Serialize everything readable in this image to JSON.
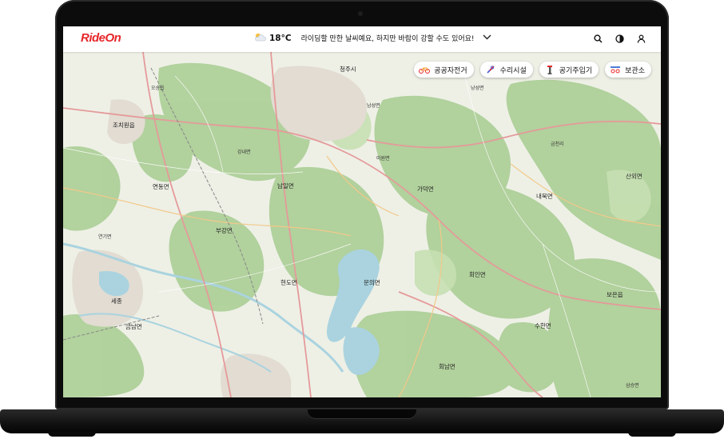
{
  "app": {
    "logo_text": "RideOn"
  },
  "weather": {
    "icon": "partly-cloudy-icon",
    "temperature": "18°C",
    "message": "라이딩할 만한 날씨예요, 하지만 바람이 강할 수도 있어요!"
  },
  "header_icons": [
    "search-icon",
    "theme-toggle-icon",
    "user-icon"
  ],
  "filters": [
    {
      "label": "공공자전거",
      "icon": "bicycle-icon"
    },
    {
      "label": "수리시설",
      "icon": "wrench-icon"
    },
    {
      "label": "공기주입기",
      "icon": "air-pump-icon"
    },
    {
      "label": "보관소",
      "icon": "bike-storage-icon"
    }
  ],
  "colors": {
    "brand": "#e8262a",
    "map_green": "#aed09a",
    "map_water": "#aad3df"
  },
  "map_labels": [
    {
      "text": "청주시"
    },
    {
      "text": "조치원읍"
    },
    {
      "text": "연동면"
    },
    {
      "text": "세종"
    },
    {
      "text": "금남면"
    },
    {
      "text": "부강면"
    },
    {
      "text": "현도면"
    },
    {
      "text": "가덕면"
    },
    {
      "text": "남일면"
    },
    {
      "text": "문의면"
    },
    {
      "text": "회인면"
    },
    {
      "text": "회남면"
    },
    {
      "text": "수한면"
    },
    {
      "text": "보은읍"
    },
    {
      "text": "산외면"
    },
    {
      "text": "내북면"
    },
    {
      "text": "낭성면"
    },
    {
      "text": "미원면"
    },
    {
      "text": "삼승면"
    },
    {
      "text": "금천리"
    },
    {
      "text": "남성면"
    },
    {
      "text": "연기면"
    },
    {
      "text": "강내면"
    },
    {
      "text": "오송읍"
    }
  ]
}
